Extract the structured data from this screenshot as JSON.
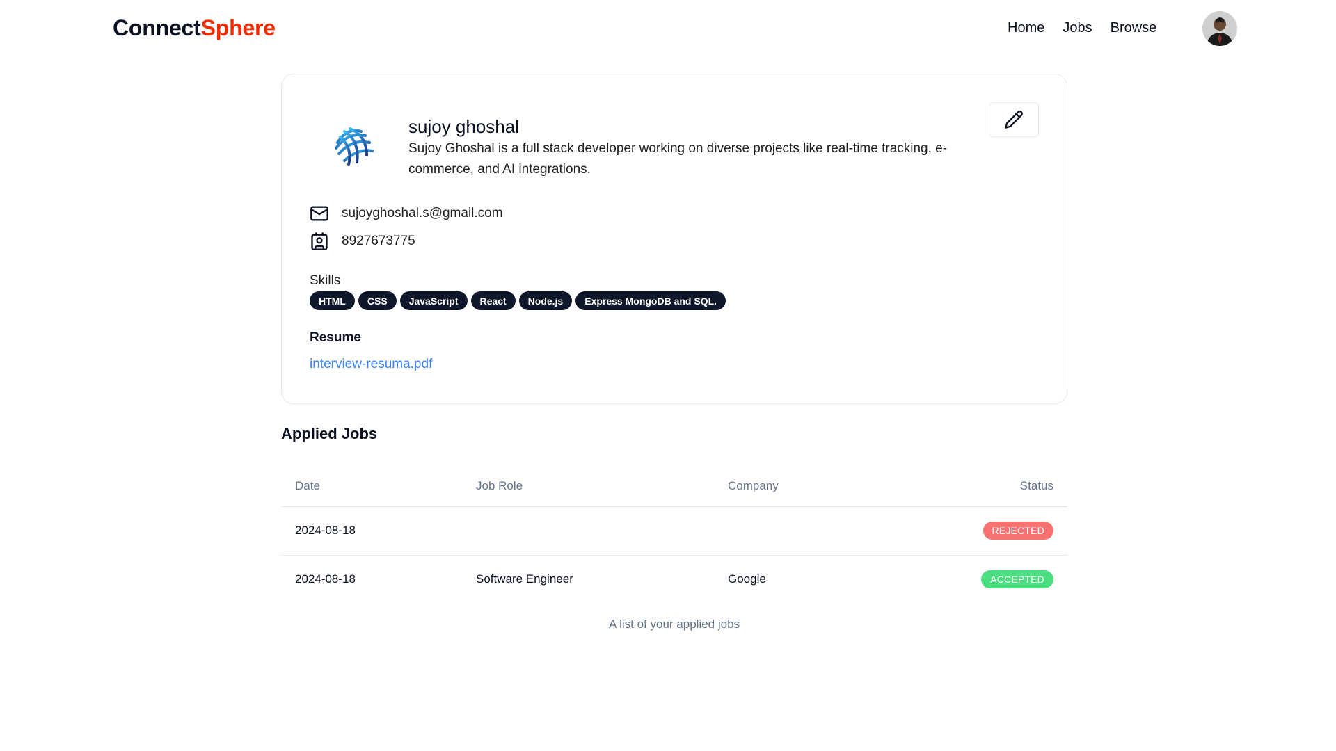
{
  "navbar": {
    "logo_primary": "Connect",
    "logo_accent": "Sphere",
    "links": [
      {
        "label": "Home"
      },
      {
        "label": "Jobs"
      },
      {
        "label": "Browse"
      }
    ],
    "avatar_icon": "user-avatar-icon"
  },
  "profile": {
    "logo_icon": "company-logo-icon",
    "name": "sujoy ghoshal",
    "bio": "Sujoy Ghoshal is a full stack developer working on diverse projects like real-time tracking, e-commerce, and AI integrations.",
    "edit_icon": "pencil-icon",
    "email_icon": "mail-icon",
    "email": "sujoyghoshal.s@gmail.com",
    "phone_icon": "contact-card-icon",
    "phone": "8927673775",
    "skills_label": "Skills",
    "skills": [
      "HTML",
      "CSS",
      "JavaScript",
      "React",
      "Node.js",
      "Express MongoDB and SQL."
    ],
    "resume_label": "Resume",
    "resume_file": "interview-resuma.pdf"
  },
  "applied_jobs": {
    "title": "Applied Jobs",
    "columns": [
      "Date",
      "Job Role",
      "Company",
      "Status"
    ],
    "rows": [
      {
        "date": "2024-08-18",
        "role": "",
        "company": "",
        "status": "REJECTED",
        "status_color": "#f87171"
      },
      {
        "date": "2024-08-18",
        "role": "Software Engineer",
        "company": "Google",
        "status": "ACCEPTED",
        "status_color": "#4ade80"
      }
    ],
    "caption": "A list of your applied jobs"
  },
  "colors": {
    "brand_accent": "#f02c04",
    "badge_dark": "#0f172a",
    "link": "#3b82f6",
    "rejected": "#f87171",
    "accepted": "#4ade80"
  }
}
